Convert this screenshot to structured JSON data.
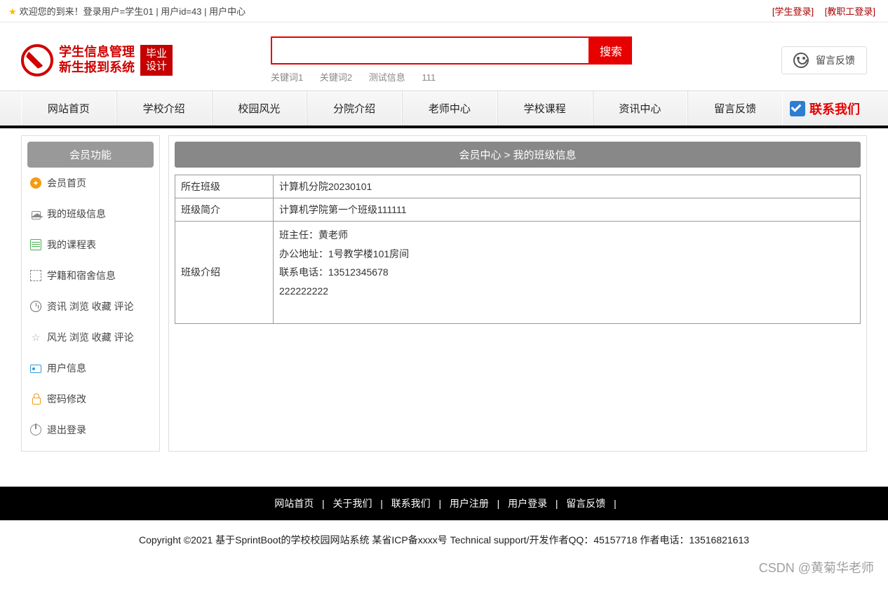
{
  "topbar": {
    "welcome": "欢迎您的到来！登录用户=学生01 | 用户id=43 | 用户中心",
    "student_login": "[学生登录]",
    "staff_login": "[教职工登录]"
  },
  "logo": {
    "line1": "学生信息管理",
    "line2": "新生报到系统",
    "badge1": "毕业",
    "badge2": "设计"
  },
  "search": {
    "value": "",
    "button": "搜索",
    "kw1": "关键词1",
    "kw2": "关键词2",
    "kw3": "测试信息",
    "kw4": "111"
  },
  "feedback_btn": "留言反馈",
  "nav": {
    "n0": "网站首页",
    "n1": "学校介绍",
    "n2": "校园风光",
    "n3": "分院介绍",
    "n4": "老师中心",
    "n5": "学校课程",
    "n6": "资讯中心",
    "n7": "留言反馈",
    "contact": "联系我们"
  },
  "sidebar": {
    "title": "会员功能",
    "s0": "会员首页",
    "s1": "我的班级信息",
    "s2": "我的课程表",
    "s3": "学籍和宿舍信息",
    "s4": "资讯 浏览 收藏 评论",
    "s5": "风光 浏览 收藏 评论",
    "s6": "用户信息",
    "s7": "密码修改",
    "s8": "退出登录"
  },
  "breadcrumb": "会员中心 > 我的班级信息",
  "table": {
    "r0l": "所在班级",
    "r0v": "计算机分院20230101",
    "r1l": "班级简介",
    "r1v": "计算机学院第一个班级111111",
    "r2l": "班级介绍",
    "r2_1": "班主任：黄老师",
    "r2_2": "办公地址：1号教学楼101房间",
    "r2_3": "联系电话：13512345678",
    "r2_4": "222222222"
  },
  "footer_nav": {
    "f0": "网站首页",
    "f1": "关于我们",
    "f2": "联系我们",
    "f3": "用户注册",
    "f4": "用户登录",
    "f5": "留言反馈"
  },
  "copyright": "Copyright ©2021 基于SprintBoot的学校校园网站系统    某省ICP备xxxx号    Technical support/开发作者QQ：45157718     作者电话：13516821613",
  "watermark": "CSDN @黄菊华老师"
}
